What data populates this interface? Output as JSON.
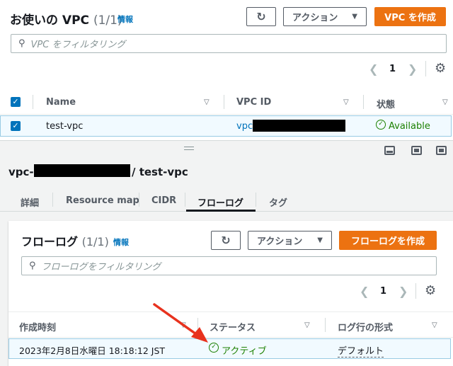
{
  "vpc_panel": {
    "title": "お使いの VPC",
    "count": "(1/1)",
    "info_label": "情報",
    "actions_label": "アクション",
    "create_label": "VPC を作成",
    "search_placeholder": "VPC をフィルタリング",
    "page_number": "1",
    "columns": [
      "Name",
      "VPC ID",
      "状態"
    ],
    "row": {
      "name": "test-vpc",
      "vpc_id_prefix": "vpc-",
      "status": "Available"
    }
  },
  "detail": {
    "title_prefix": "vpc-",
    "title_suffix": "/ test-vpc",
    "tabs": [
      "詳細",
      "Resource map",
      "CIDR",
      "フローログ",
      "タグ"
    ],
    "active_tab": 3
  },
  "flowlog_panel": {
    "title": "フローログ",
    "count": "(1/1)",
    "info_label": "情報",
    "actions_label": "アクション",
    "create_label": "フローログを作成",
    "search_placeholder": "フローログをフィルタリング",
    "page_number": "1",
    "columns": [
      "作成時刻",
      "ステータス",
      "ログ行の形式"
    ],
    "row": {
      "created": "2023年2月8日水曜日 18:18:12 JST",
      "status": "アクティブ",
      "format": "デフォルト"
    }
  },
  "colors": {
    "accent": "#ec7211",
    "link": "#0073bb",
    "success": "#1d8102",
    "annotation_arrow": "#e8321e"
  }
}
